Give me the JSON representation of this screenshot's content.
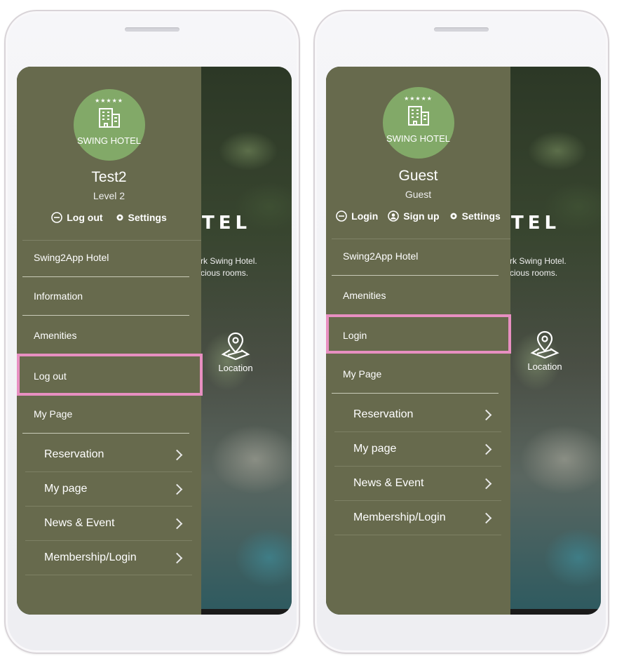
{
  "background": {
    "title": "TEL",
    "subtitle_line1": "rk Swing Hotel.",
    "subtitle_line2": "cious rooms.",
    "location_label": "Location"
  },
  "logo": {
    "stars": "★★★★★",
    "name": "SWING HOTEL"
  },
  "left": {
    "user_name": "Test2",
    "user_level": "Level 2",
    "actions": {
      "logout": "Log  out",
      "settings": "Settings"
    },
    "menu": [
      "Swing2App Hotel",
      "Information",
      "Amenities",
      "Log out",
      "My Page"
    ],
    "submenu": [
      "Reservation",
      "My page",
      "News & Event",
      "Membership/Login"
    ]
  },
  "right": {
    "user_name": "Guest",
    "user_level": "Guest",
    "actions": {
      "login": "Login",
      "signup": "Sign  up",
      "settings": "Settings"
    },
    "menu": [
      "Swing2App Hotel",
      "Amenities",
      "Login",
      "My Page"
    ],
    "submenu": [
      "Reservation",
      "My page",
      "News & Event",
      "Membership/Login"
    ]
  },
  "colors": {
    "drawer": "#676a4d",
    "logo": "#82a968",
    "highlight": "#e88fc1"
  }
}
